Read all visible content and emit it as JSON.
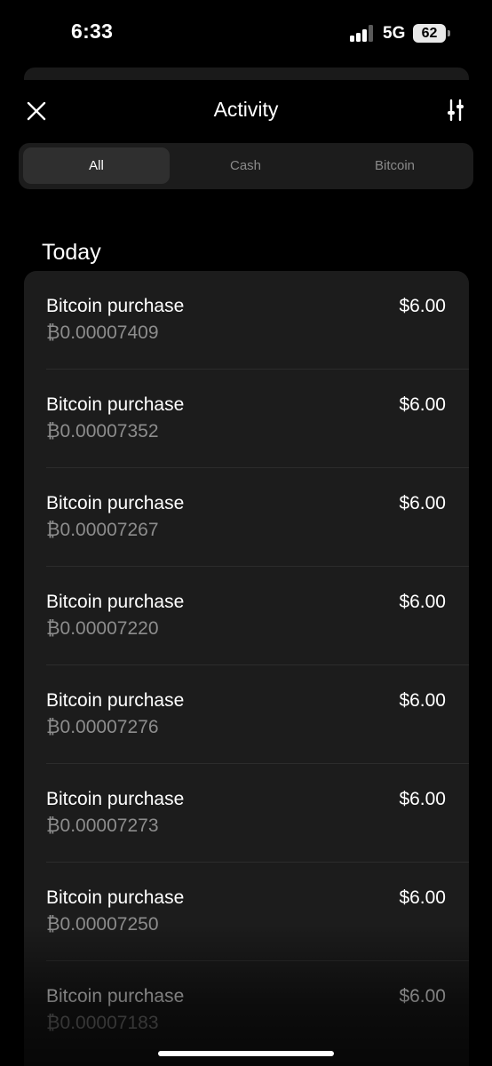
{
  "status_bar": {
    "time": "6:33",
    "network": "5G",
    "battery": "62"
  },
  "header": {
    "title": "Activity",
    "close_icon": "close-icon",
    "filter_icon": "sliders-icon"
  },
  "tabs": [
    {
      "label": "All",
      "active": true
    },
    {
      "label": "Cash",
      "active": false
    },
    {
      "label": "Bitcoin",
      "active": false
    }
  ],
  "section": {
    "title": "Today"
  },
  "transactions": [
    {
      "title": "Bitcoin purchase",
      "btc": "₿0.00007409",
      "amount": "$6.00"
    },
    {
      "title": "Bitcoin purchase",
      "btc": "₿0.00007352",
      "amount": "$6.00"
    },
    {
      "title": "Bitcoin purchase",
      "btc": "₿0.00007267",
      "amount": "$6.00"
    },
    {
      "title": "Bitcoin purchase",
      "btc": "₿0.00007220",
      "amount": "$6.00"
    },
    {
      "title": "Bitcoin purchase",
      "btc": "₿0.00007276",
      "amount": "$6.00"
    },
    {
      "title": "Bitcoin purchase",
      "btc": "₿0.00007273",
      "amount": "$6.00"
    },
    {
      "title": "Bitcoin purchase",
      "btc": "₿0.00007250",
      "amount": "$6.00"
    },
    {
      "title": "Bitcoin purchase",
      "btc": "₿0.00007183",
      "amount": "$6.00"
    }
  ],
  "colors": {
    "background": "#000000",
    "card": "#1c1c1c",
    "active_segment": "#2f2f2f",
    "secondary_text": "#8d8d8d"
  }
}
